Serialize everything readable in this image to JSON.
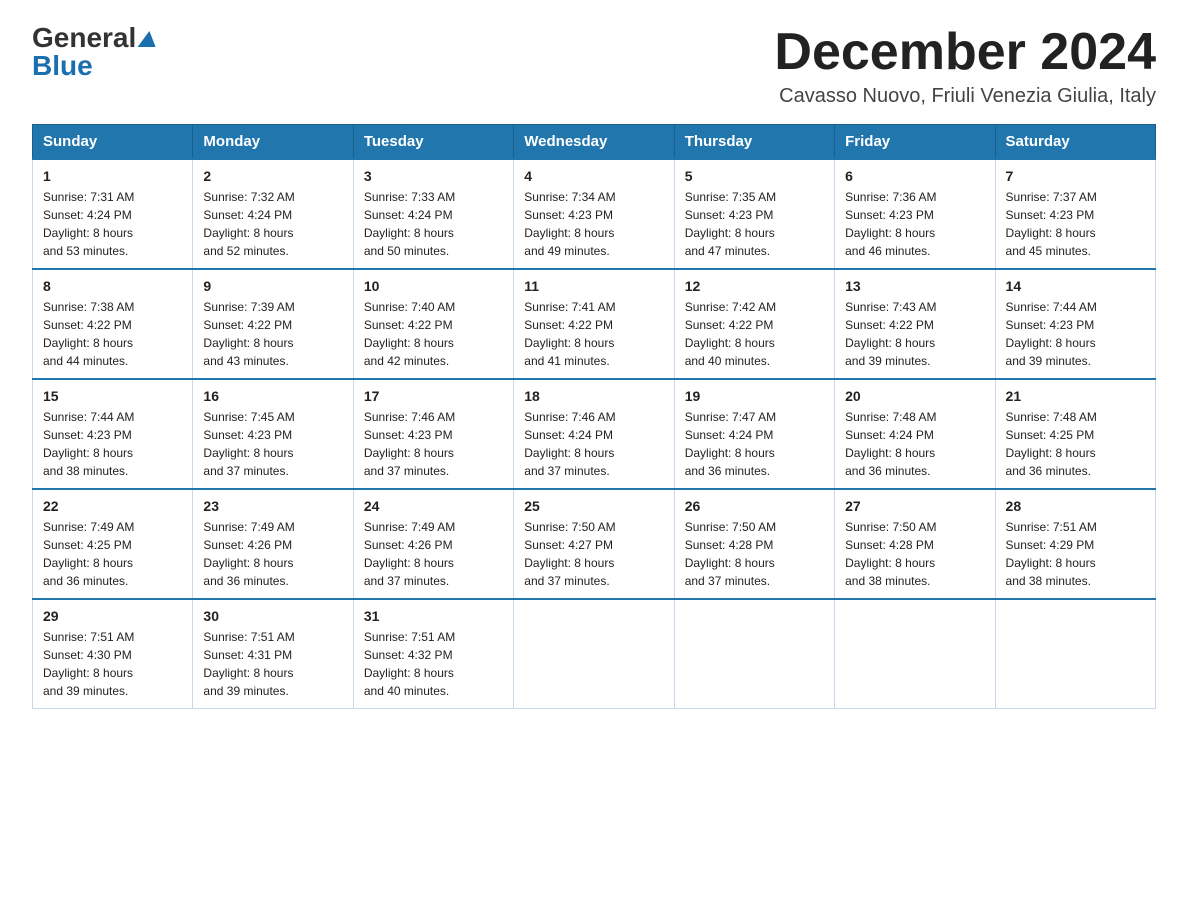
{
  "logo": {
    "general": "General",
    "blue": "Blue"
  },
  "title": "December 2024",
  "location": "Cavasso Nuovo, Friuli Venezia Giulia, Italy",
  "days_of_week": [
    "Sunday",
    "Monday",
    "Tuesday",
    "Wednesday",
    "Thursday",
    "Friday",
    "Saturday"
  ],
  "weeks": [
    [
      {
        "day": "1",
        "sunrise": "7:31 AM",
        "sunset": "4:24 PM",
        "daylight": "8 hours and 53 minutes."
      },
      {
        "day": "2",
        "sunrise": "7:32 AM",
        "sunset": "4:24 PM",
        "daylight": "8 hours and 52 minutes."
      },
      {
        "day": "3",
        "sunrise": "7:33 AM",
        "sunset": "4:24 PM",
        "daylight": "8 hours and 50 minutes."
      },
      {
        "day": "4",
        "sunrise": "7:34 AM",
        "sunset": "4:23 PM",
        "daylight": "8 hours and 49 minutes."
      },
      {
        "day": "5",
        "sunrise": "7:35 AM",
        "sunset": "4:23 PM",
        "daylight": "8 hours and 47 minutes."
      },
      {
        "day": "6",
        "sunrise": "7:36 AM",
        "sunset": "4:23 PM",
        "daylight": "8 hours and 46 minutes."
      },
      {
        "day": "7",
        "sunrise": "7:37 AM",
        "sunset": "4:23 PM",
        "daylight": "8 hours and 45 minutes."
      }
    ],
    [
      {
        "day": "8",
        "sunrise": "7:38 AM",
        "sunset": "4:22 PM",
        "daylight": "8 hours and 44 minutes."
      },
      {
        "day": "9",
        "sunrise": "7:39 AM",
        "sunset": "4:22 PM",
        "daylight": "8 hours and 43 minutes."
      },
      {
        "day": "10",
        "sunrise": "7:40 AM",
        "sunset": "4:22 PM",
        "daylight": "8 hours and 42 minutes."
      },
      {
        "day": "11",
        "sunrise": "7:41 AM",
        "sunset": "4:22 PM",
        "daylight": "8 hours and 41 minutes."
      },
      {
        "day": "12",
        "sunrise": "7:42 AM",
        "sunset": "4:22 PM",
        "daylight": "8 hours and 40 minutes."
      },
      {
        "day": "13",
        "sunrise": "7:43 AM",
        "sunset": "4:22 PM",
        "daylight": "8 hours and 39 minutes."
      },
      {
        "day": "14",
        "sunrise": "7:44 AM",
        "sunset": "4:23 PM",
        "daylight": "8 hours and 39 minutes."
      }
    ],
    [
      {
        "day": "15",
        "sunrise": "7:44 AM",
        "sunset": "4:23 PM",
        "daylight": "8 hours and 38 minutes."
      },
      {
        "day": "16",
        "sunrise": "7:45 AM",
        "sunset": "4:23 PM",
        "daylight": "8 hours and 37 minutes."
      },
      {
        "day": "17",
        "sunrise": "7:46 AM",
        "sunset": "4:23 PM",
        "daylight": "8 hours and 37 minutes."
      },
      {
        "day": "18",
        "sunrise": "7:46 AM",
        "sunset": "4:24 PM",
        "daylight": "8 hours and 37 minutes."
      },
      {
        "day": "19",
        "sunrise": "7:47 AM",
        "sunset": "4:24 PM",
        "daylight": "8 hours and 36 minutes."
      },
      {
        "day": "20",
        "sunrise": "7:48 AM",
        "sunset": "4:24 PM",
        "daylight": "8 hours and 36 minutes."
      },
      {
        "day": "21",
        "sunrise": "7:48 AM",
        "sunset": "4:25 PM",
        "daylight": "8 hours and 36 minutes."
      }
    ],
    [
      {
        "day": "22",
        "sunrise": "7:49 AM",
        "sunset": "4:25 PM",
        "daylight": "8 hours and 36 minutes."
      },
      {
        "day": "23",
        "sunrise": "7:49 AM",
        "sunset": "4:26 PM",
        "daylight": "8 hours and 36 minutes."
      },
      {
        "day": "24",
        "sunrise": "7:49 AM",
        "sunset": "4:26 PM",
        "daylight": "8 hours and 37 minutes."
      },
      {
        "day": "25",
        "sunrise": "7:50 AM",
        "sunset": "4:27 PM",
        "daylight": "8 hours and 37 minutes."
      },
      {
        "day": "26",
        "sunrise": "7:50 AM",
        "sunset": "4:28 PM",
        "daylight": "8 hours and 37 minutes."
      },
      {
        "day": "27",
        "sunrise": "7:50 AM",
        "sunset": "4:28 PM",
        "daylight": "8 hours and 38 minutes."
      },
      {
        "day": "28",
        "sunrise": "7:51 AM",
        "sunset": "4:29 PM",
        "daylight": "8 hours and 38 minutes."
      }
    ],
    [
      {
        "day": "29",
        "sunrise": "7:51 AM",
        "sunset": "4:30 PM",
        "daylight": "8 hours and 39 minutes."
      },
      {
        "day": "30",
        "sunrise": "7:51 AM",
        "sunset": "4:31 PM",
        "daylight": "8 hours and 39 minutes."
      },
      {
        "day": "31",
        "sunrise": "7:51 AM",
        "sunset": "4:32 PM",
        "daylight": "8 hours and 40 minutes."
      },
      null,
      null,
      null,
      null
    ]
  ]
}
